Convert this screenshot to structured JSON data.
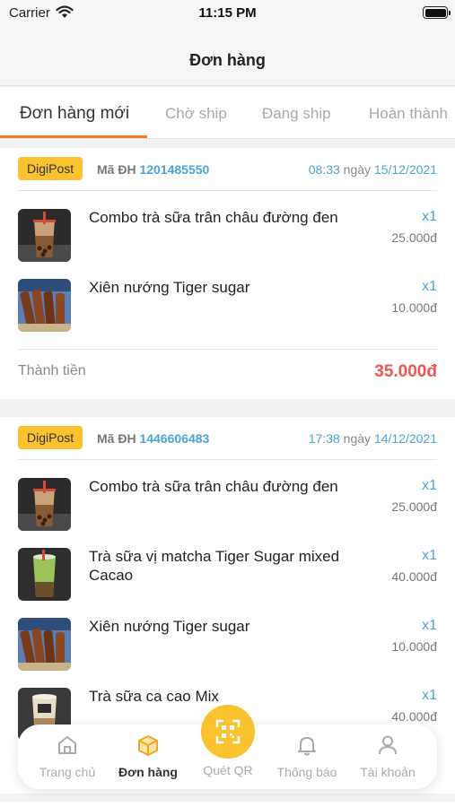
{
  "status": {
    "carrier": "Carrier",
    "time": "11:15 PM"
  },
  "nav": {
    "title": "Đơn hàng"
  },
  "tabs": [
    {
      "label": "Đơn hàng mới",
      "active": true
    },
    {
      "label": "Chờ ship"
    },
    {
      "label": "Đang ship"
    },
    {
      "label": "Hoàn thành"
    }
  ],
  "orders": [
    {
      "badge": "DigiPost",
      "id_label": "Mã ĐH",
      "id": "1201485550",
      "time": "08:33",
      "date_label": "ngày",
      "date": "15/12/2021",
      "items": [
        {
          "name": "Combo trà sữa trân châu đường đen",
          "qty": "x1",
          "price": "25.000đ",
          "image": "bubble-tea-brown-sugar"
        },
        {
          "name": "Xiên nướng Tiger sugar",
          "qty": "x1",
          "price": "10.000đ",
          "image": "grilled-skewers"
        }
      ],
      "total_label": "Thành tiền",
      "total": "35.000đ"
    },
    {
      "badge": "DigiPost",
      "id_label": "Mã ĐH",
      "id": "1446606483",
      "time": "17:38",
      "date_label": "ngày",
      "date": "14/12/2021",
      "items": [
        {
          "name": "Combo trà sữa trân châu đường đen",
          "qty": "x1",
          "price": "25.000đ",
          "image": "bubble-tea-brown-sugar"
        },
        {
          "name": "Trà sữa vị matcha Tiger Sugar mixed Cacao",
          "qty": "x1",
          "price": "40.000đ",
          "image": "matcha-milk-tea"
        },
        {
          "name": "Xiên nướng Tiger sugar",
          "qty": "x1",
          "price": "10.000đ",
          "image": "grilled-skewers"
        },
        {
          "name": "Trà sữa ca cao Mix",
          "qty": "x1",
          "price": "40.000đ",
          "image": "cocoa-milk-tea"
        }
      ]
    }
  ],
  "tabbar": {
    "items": [
      {
        "label": "Trang chủ",
        "icon": "home-icon"
      },
      {
        "label": "Đơn hàng",
        "icon": "package-icon",
        "active": true
      },
      {
        "label": "Quét QR",
        "icon": "qr-scan-icon"
      },
      {
        "label": "Thông báo",
        "icon": "bell-icon"
      },
      {
        "label": "Tài khoản",
        "icon": "user-icon"
      }
    ]
  },
  "colors": {
    "accent": "#f9c22e",
    "tab_indicator": "#f47920",
    "link_blue": "#4aa3d6",
    "total_red": "#f05454"
  }
}
